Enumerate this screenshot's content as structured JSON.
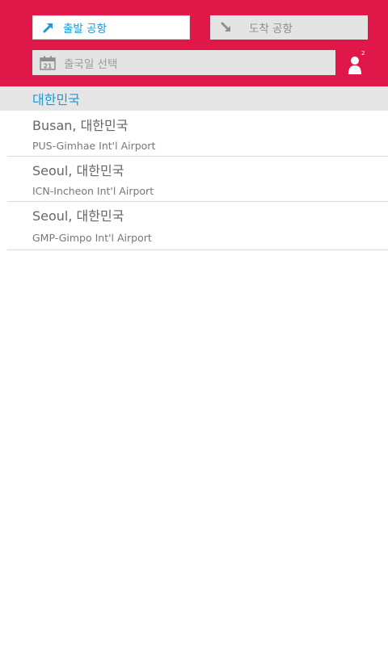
{
  "search": {
    "departure": {
      "label": "출발 공항",
      "icon": "departure-arrow-icon"
    },
    "arrival": {
      "label": "도착 공항",
      "icon": "arrival-arrow-icon"
    },
    "date": {
      "label": "출국일 선택",
      "icon": "calendar-icon",
      "day": "21"
    },
    "passengers": {
      "count": "2",
      "icon": "person-icon"
    }
  },
  "section": {
    "title": "대한민국"
  },
  "airports": [
    {
      "city": "Busan, 대한민국",
      "airport": "PUS-Gimhae Int'l Airport"
    },
    {
      "city": "Seoul, 대한민국",
      "airport": "ICN-Incheon Int'l Airport"
    },
    {
      "city": "Seoul, 대한민국",
      "airport": "GMP-Gimpo Int'l Airport"
    }
  ],
  "colors": {
    "header": "#e0184a",
    "accent": "#1a9ad6",
    "section_bg": "#e6e6e6"
  }
}
